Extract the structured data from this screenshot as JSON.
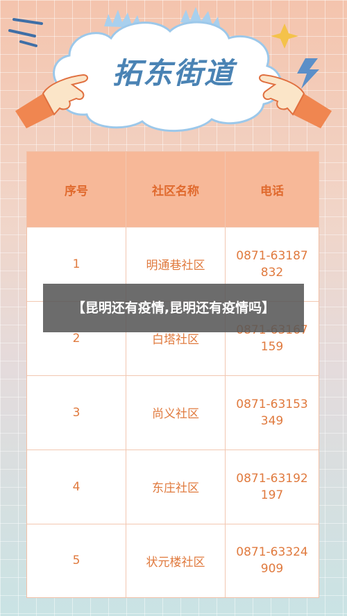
{
  "banner": {
    "title": "拓东街道"
  },
  "table": {
    "headers": [
      "序号",
      "社区名称",
      "电话"
    ],
    "rows": [
      {
        "no": "1",
        "name": "明通巷社区",
        "phone": "0871-63187832"
      },
      {
        "no": "2",
        "name": "白塔社区",
        "phone": "0871-63167159"
      },
      {
        "no": "3",
        "name": "尚义社区",
        "phone": "0871-63153349"
      },
      {
        "no": "4",
        "name": "东庄社区",
        "phone": "0871-63192197"
      },
      {
        "no": "5",
        "name": "状元楼社区",
        "phone": "0871-63324909"
      }
    ]
  },
  "overlay": {
    "text": "【昆明还有疫情,昆明还有疫情吗】"
  },
  "colors": {
    "header_bg": "#f7b898",
    "accent": "#e06a2e",
    "title_blue": "#4a83b4"
  }
}
